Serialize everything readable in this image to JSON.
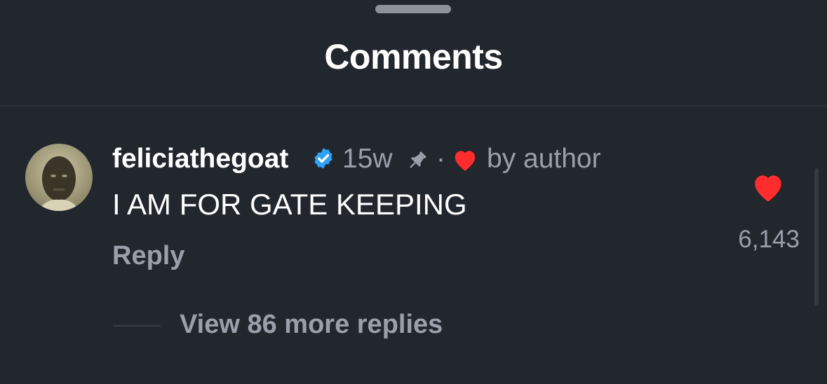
{
  "sheet": {
    "title": "Comments"
  },
  "comment": {
    "username": "feliciathegoat",
    "verified_icon": "verified-badge-icon",
    "time": "15w",
    "pin_icon": "pin-icon",
    "separator": "·",
    "liked_by_icon": "heart-icon",
    "liked_by": "by author",
    "text": "I AM FOR GATE KEEPING",
    "reply_label": "Reply",
    "like_count": "6,143",
    "view_replies": "View 86 more replies"
  },
  "colors": {
    "background": "#22262d",
    "heart": "#fe2c2c",
    "verified": "#2ea2f6",
    "muted_text": "#9aa0aa"
  }
}
